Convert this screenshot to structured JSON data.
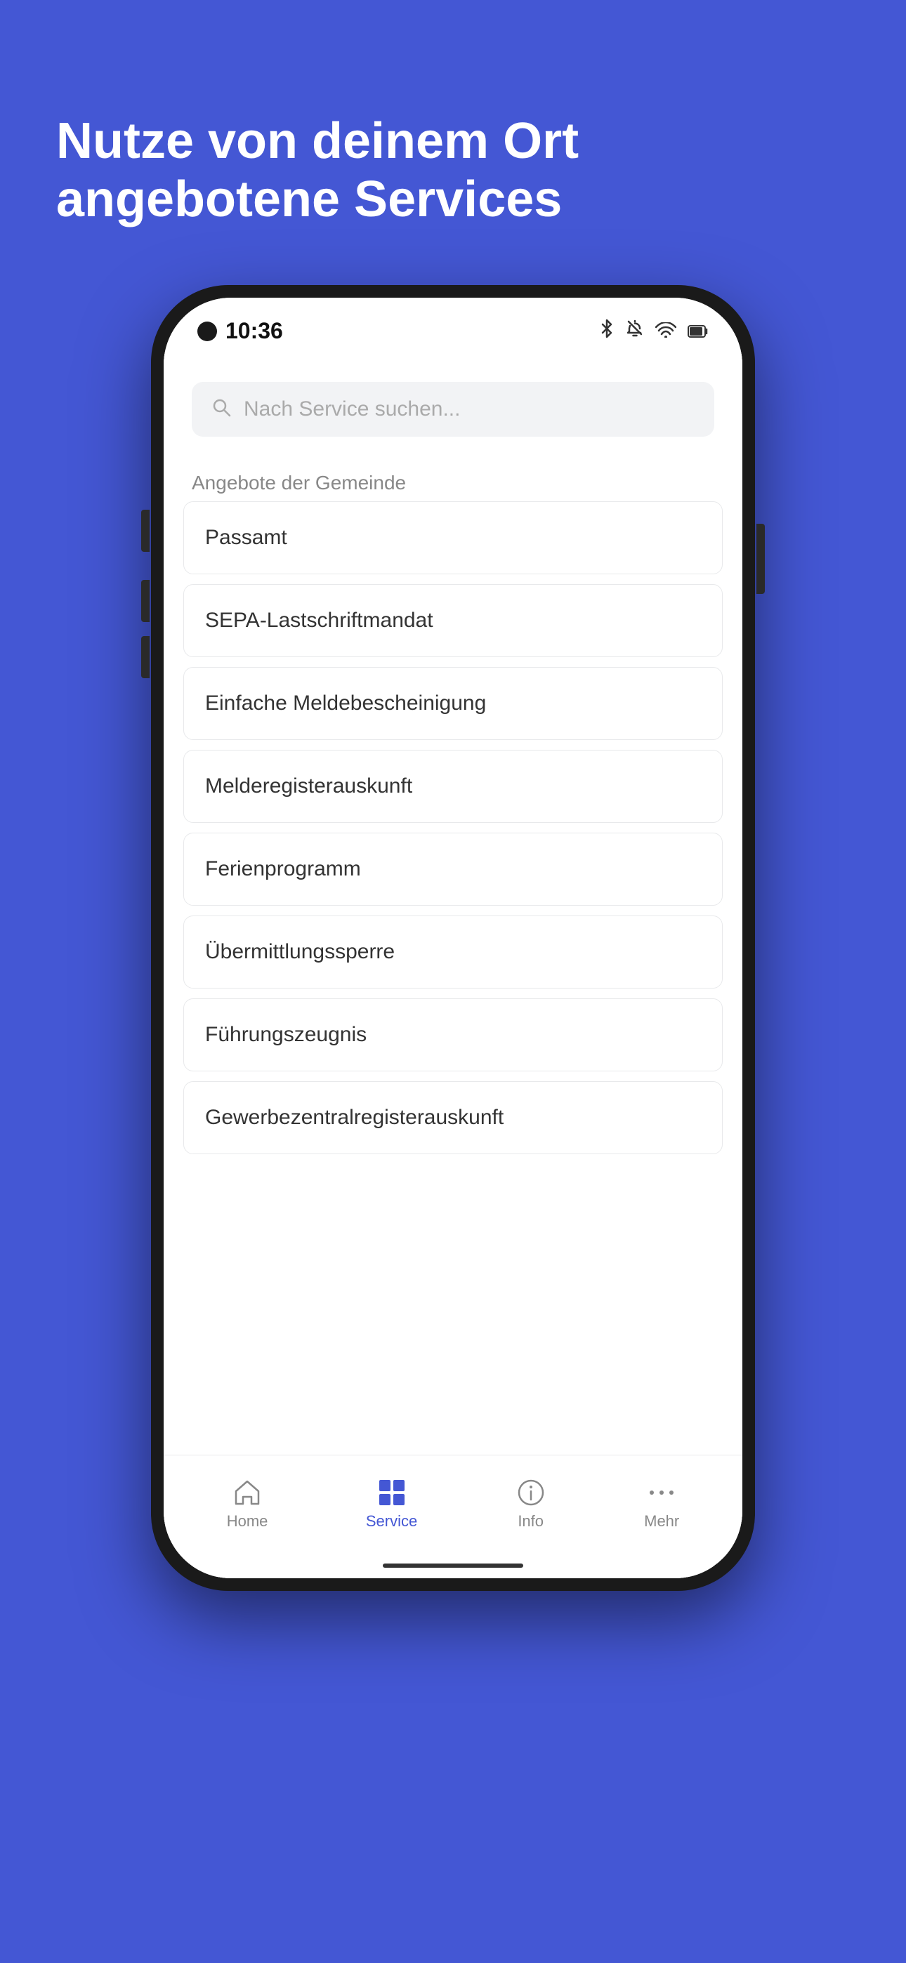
{
  "background_color": "#4457D4",
  "hero": {
    "title": "Nutze von deinem Ort angebotene Services"
  },
  "phone": {
    "status_bar": {
      "time": "10:36",
      "icons": [
        "bluetooth",
        "bell-off",
        "wifi",
        "battery"
      ]
    },
    "search": {
      "placeholder": "Nach Service suchen..."
    },
    "section_title": "Angebote der Gemeinde",
    "services": [
      {
        "name": "Passamt"
      },
      {
        "name": "SEPA-Lastschriftmandat"
      },
      {
        "name": "Einfache Meldebescheinigung"
      },
      {
        "name": "Melderegisterauskunft"
      },
      {
        "name": "Ferienprogramm"
      },
      {
        "name": "Übermittlungssperre"
      },
      {
        "name": "Führungszeugnis"
      },
      {
        "name": "Gewerbezentralregisterauskunft"
      }
    ],
    "bottom_nav": [
      {
        "id": "home",
        "label": "Home",
        "active": false
      },
      {
        "id": "service",
        "label": "Service",
        "active": true
      },
      {
        "id": "info",
        "label": "Info",
        "active": false
      },
      {
        "id": "mehr",
        "label": "Mehr",
        "active": false
      }
    ]
  }
}
